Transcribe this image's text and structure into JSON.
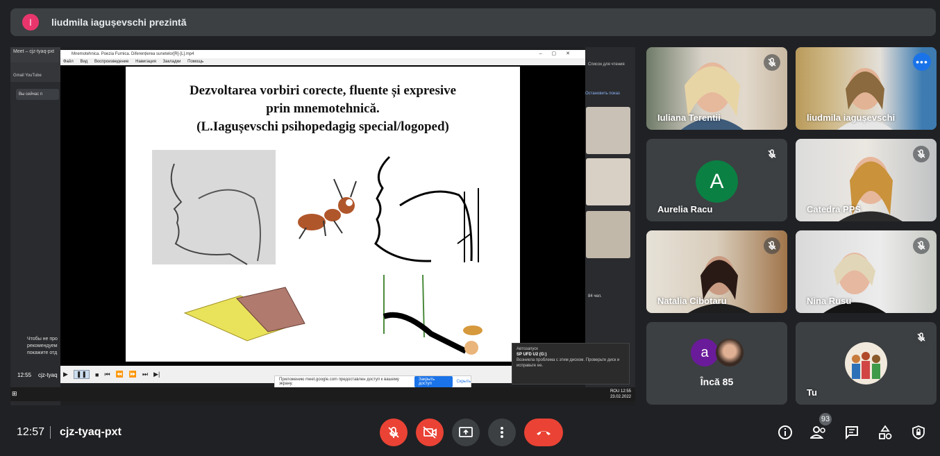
{
  "banner": {
    "avatar_letter": "l",
    "text": "liudmila iagușevschi prezintă"
  },
  "shared_screen": {
    "browser_tabs": "Meet – cjz-tyaq-pxt",
    "bookmarks": "Gmail   YouTube",
    "share_button": "Вы сейчас п",
    "side_note": "Чтобы не про рекомендуем покажите отд",
    "time_left": "12:55",
    "code_left": "cjz-tyaq",
    "player_title": "Mnemotehnica. Poezia Furnica. Diferențierea sunetelor[R]-[L].mp4",
    "player_menu": [
      "Файл",
      "Вид",
      "Воспроизведение",
      "Навигация",
      "Закладки",
      "Помощь"
    ],
    "slide_title": "Dezvoltarea vorbiri corecte,  fluente  și  expresive\nprin mnemotehnică.\n(L.Iagușevschi psihopedagig special/logoped)",
    "player_status": "Пауза [H/W]",
    "popup_text": "Приложению meet.google.com предоставлен доступ к вашему экрану.",
    "popup_btn": "Закрыть доступ",
    "popup_link": "Скрыть",
    "stop_showing": "Остановить показ",
    "right_count": "84 чел.",
    "reading_list": "Список для чтения",
    "toast_head": "Автозапуск",
    "toast_title": "SP UFD U2 (G:)",
    "toast_body": "Возникла проблема с этим диском. Проверьте диск и исправьте ее.",
    "tray_time": "12:55",
    "tray_date": "23.02.2022",
    "tray_lang": "ROU"
  },
  "participants": [
    {
      "name": "Iuliana Terentii",
      "muted": true
    },
    {
      "name": "liudmila iagușevschi",
      "muted": false,
      "active": true
    },
    {
      "name": "Aurelia Racu",
      "muted": true,
      "avatar_letter": "A",
      "avatar_color": "#0b8043"
    },
    {
      "name": "Catedra PPS",
      "muted": true
    },
    {
      "name": "Natalia Cibotaru",
      "muted": true
    },
    {
      "name": "Nina Rusu",
      "muted": true
    },
    {
      "name": "Încă 85",
      "avatar_letter": "a",
      "avatar_color": "#6a1b9a"
    },
    {
      "name": "Tu",
      "muted": true
    }
  ],
  "bottom": {
    "time": "12:57",
    "meeting_code": "cjz-tyaq-pxt",
    "participants_count": "93"
  },
  "colors": {
    "accent": "#1a73e8",
    "danger": "#ea4335",
    "tile": "#3c4043",
    "bg": "#202124"
  }
}
